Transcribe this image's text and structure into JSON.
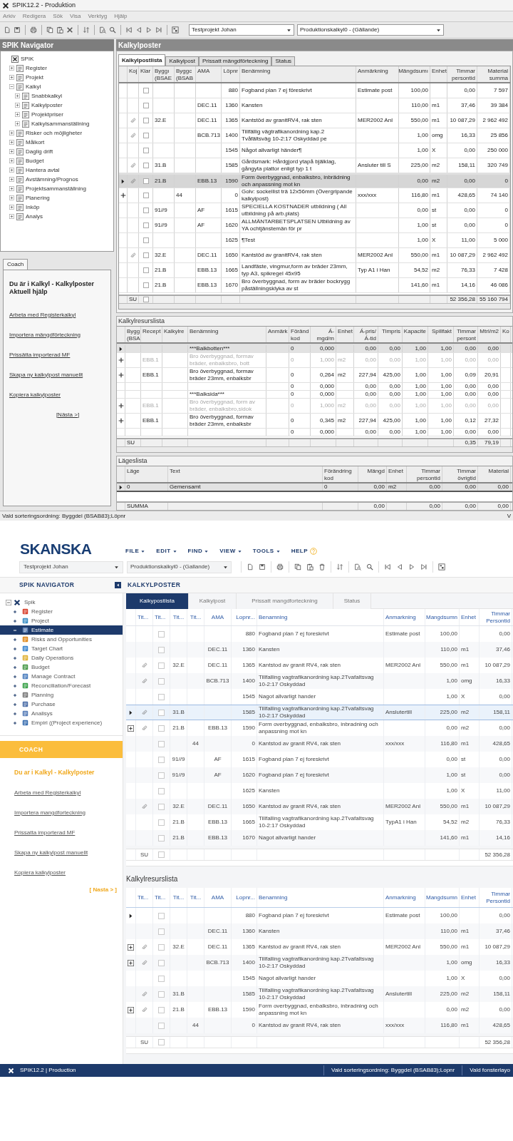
{
  "classic": {
    "window": {
      "title": "SPIK12.2 - Produktion"
    },
    "menu": [
      "Arkiv",
      "Redigera",
      "Sök",
      "Visa",
      "Verktyg",
      "Hjälp"
    ],
    "project_select": {
      "value": "Testprojekt Johan"
    },
    "estimate_select": {
      "value": "Produktionskalkyl0 -  (Gällande)"
    },
    "navigator": {
      "title": "SPIK Navigator",
      "tree": [
        {
          "label": "SPIK",
          "children": [
            {
              "label": "Register",
              "expanded": false
            },
            {
              "label": "Projekt",
              "expanded": false
            },
            {
              "label": "Kalkyl",
              "expanded": true,
              "children": [
                {
                  "label": "Snabbkalkyl",
                  "expanded": false
                },
                {
                  "label": "Kalkylposter",
                  "expanded": false
                },
                {
                  "label": "Projektpriser",
                  "expanded": false
                },
                {
                  "label": "Kalkylsammanställning",
                  "expanded": false
                }
              ]
            },
            {
              "label": "Risker och möjligheter",
              "expanded": false
            },
            {
              "label": "Målkort",
              "expanded": false
            },
            {
              "label": "Daglig drift",
              "expanded": false
            },
            {
              "label": "Budget",
              "expanded": false
            },
            {
              "label": "Hantera avtal",
              "expanded": false
            },
            {
              "label": "Avstämning/Prognos",
              "expanded": false
            },
            {
              "label": "Projektsammanställning",
              "expanded": false
            },
            {
              "label": "Planering",
              "expanded": false
            },
            {
              "label": "Inköp",
              "expanded": false
            },
            {
              "label": "Analys",
              "expanded": false
            }
          ]
        }
      ]
    },
    "coach": {
      "tab": "Coach",
      "title": "Du är i Kalkyl - Kalkylposter",
      "subtitle": "Aktuell hjälp",
      "links": [
        "Arbeta med Registerkalkyl",
        "Importera mängdförteckning",
        "Prissätta importerad MF",
        "Skapa ny kalkylpost manuellt",
        "Kopiera kalkylposter"
      ],
      "next": "[Nästa >]"
    },
    "content_title": "Kalkylposter",
    "tabs": [
      {
        "label": "Kalkylpostlista",
        "selected": true
      },
      {
        "label": "Kalkylpost",
        "selected": false
      },
      {
        "label": "Prissatt mängdförteckning",
        "selected": false
      },
      {
        "label": "Status",
        "selected": false
      }
    ],
    "estimate_table": {
      "columns": [
        "Koj",
        "Klar",
        "Byggı (BSAE",
        "Byggc (BSAB",
        "AMA",
        "Löpnr",
        "Benämning",
        "Anmärkning",
        "Mängdsumı",
        "Enhet",
        "Timmar persontid",
        "Material summa"
      ],
      "rows": [
        {
          "current": false,
          "expandable": false,
          "attachment": false,
          "checked": false,
          "selected": false,
          "cells": [
            "",
            "",
            "",
            "",
            "",
            "880",
            "Fogband plan 7 ej föreskrivt",
            "Estimate post",
            "100,00",
            "",
            "0,00",
            "7 597"
          ]
        },
        {
          "current": false,
          "expandable": false,
          "attachment": false,
          "checked": false,
          "selected": false,
          "cells": [
            "",
            "",
            "",
            "",
            "DEC.11",
            "1360",
            "Kansten",
            "",
            "110,00",
            "m1",
            "37,46",
            "39 384"
          ]
        },
        {
          "current": false,
          "expandable": false,
          "attachment": true,
          "checked": false,
          "selected": false,
          "cells": [
            "",
            "",
            "32.E",
            "",
            "DEC.11",
            "1365",
            "Kantstöd av granitRV4, rak sten",
            "MER2002 Anl",
            "550,00",
            "m1",
            "10 087,29",
            "2 962 492"
          ]
        },
        {
          "current": false,
          "expandable": false,
          "attachment": true,
          "checked": false,
          "selected": false,
          "cells": [
            "",
            "",
            "",
            "",
            "BCB.713",
            "1400",
            "Tillfällig vägtrafikanordning kap.2 Tvåfältsväg 10-2:17 Oskyddad pe",
            "",
            "1,00",
            "omg",
            "16,33",
            "25 856"
          ]
        },
        {
          "current": false,
          "expandable": false,
          "attachment": false,
          "checked": false,
          "selected": false,
          "cells": [
            "",
            "",
            "",
            "",
            "",
            "1545",
            "Något allvarligt händer¶",
            "",
            "1,00",
            "X",
            "0,00",
            "250 000"
          ]
        },
        {
          "current": false,
          "expandable": false,
          "attachment": true,
          "checked": false,
          "selected": false,
          "cells": [
            "",
            "",
            "31.B",
            "",
            "",
            "1585",
            "Gårdsmark: Hårdgjord ytapå bjälklag, gångyta plattor enligt typ 1 t",
            "Ansluter till S",
            "225,00",
            "m2",
            "158,11",
            "320 749"
          ]
        },
        {
          "current": true,
          "expandable": false,
          "attachment": true,
          "checked": false,
          "selected": true,
          "cells": [
            "",
            "",
            "21.B",
            "",
            "EBB.13",
            "1590",
            "Form överbyggnad, enbalksbro, inbrädning och anpassning mot kn",
            "",
            "0,00",
            "m2",
            "0,00",
            "0"
          ]
        },
        {
          "current": false,
          "expandable": true,
          "attachment": false,
          "checked": false,
          "selected": false,
          "cells": [
            "",
            "",
            "",
            "44",
            "",
            "0",
            "Golv: sockellist trä 12x56mm (Övergripande kalkylpost)",
            "xxx/xxx",
            "116,80",
            "m1",
            "428,65",
            "74 140"
          ]
        },
        {
          "current": false,
          "expandable": false,
          "attachment": false,
          "checked": false,
          "selected": false,
          "cells": [
            "",
            "",
            "91//9",
            "",
            "AF",
            "1615",
            "SPECIELLA KOSTNADER utbildning ( All utbildning på arb.plats)",
            "",
            "0,00",
            "st",
            "0,00",
            "0"
          ]
        },
        {
          "current": false,
          "expandable": false,
          "attachment": false,
          "checked": false,
          "selected": false,
          "cells": [
            "",
            "",
            "91//9",
            "",
            "AF",
            "1620",
            "ALLMÄNTARBETSPLATSEN Utbildning av YA ochtjänstemän för pr",
            "",
            "1,00",
            "st",
            "0,00",
            "0"
          ]
        },
        {
          "current": false,
          "expandable": false,
          "attachment": false,
          "checked": false,
          "selected": false,
          "cells": [
            "",
            "",
            "",
            "",
            "",
            "1625",
            "¶Test",
            "",
            "1,00",
            "X",
            "11,00",
            "5 000"
          ]
        },
        {
          "current": false,
          "expandable": false,
          "attachment": true,
          "checked": false,
          "selected": false,
          "cells": [
            "",
            "",
            "32.E",
            "",
            "DEC.11",
            "1650",
            "Kantstöd av granitRV4, rak sten",
            "MER2002 Anl",
            "550,00",
            "m1",
            "10 087,29",
            "2 962 492"
          ]
        },
        {
          "current": false,
          "expandable": false,
          "attachment": false,
          "checked": false,
          "selected": false,
          "cells": [
            "",
            "",
            "21.B",
            "",
            "EBB.13",
            "1665",
            "Landfäste, vingmur,form av bräder 23mm, typ A3, spikregel 45x95",
            "Typ A1 i Han",
            "54,52",
            "m2",
            "76,33",
            "7 428"
          ]
        },
        {
          "current": false,
          "expandable": false,
          "attachment": false,
          "checked": false,
          "selected": false,
          "cells": [
            "",
            "",
            "21.B",
            "",
            "EBB.13",
            "1670",
            "Bro överbyggnad, form av bräder bockrygg påställningsklyka av st",
            "",
            "141,60",
            "m1",
            "14,16",
            "46 086"
          ]
        }
      ],
      "sum": {
        "checked": false,
        "cells": [
          "SU",
          "",
          "",
          "",
          "",
          "",
          "",
          "",
          "",
          "",
          "52 356,28",
          "55 160 794"
        ]
      }
    },
    "resource_table": {
      "title": "Kalkylresurslista",
      "columns": [
        "Bygg (BSA",
        "Recept",
        "Kalkylre",
        "Benämning",
        "Anmärk",
        "Föränd kod",
        "Á-mgd/m",
        "Enhet",
        "Á-pris/ Á-tid",
        "Timpris",
        "Kapacite",
        "Spillfakt",
        "Timmar persont",
        "Mtrl/m2",
        "Ko"
      ],
      "rows": [
        {
          "current": true,
          "expandable": false,
          "disabled": false,
          "selected": true,
          "cells": [
            "",
            "",
            "",
            "***Balkbotten***",
            "",
            "0",
            "0,000",
            "",
            "0,00",
            "0,00",
            "1,00",
            "1,00",
            "0,00",
            "0,00",
            ""
          ]
        },
        {
          "current": false,
          "expandable": true,
          "disabled": true,
          "selected": false,
          "cells": [
            "",
            "EBB.1",
            "",
            "Bro överbyggnad, formav bräder, enbalksbro, bott",
            "",
            "0",
            "1,000",
            "m2",
            "0,00",
            "0,00",
            "1,00",
            "1,00",
            "0,00",
            "0,00",
            ""
          ]
        },
        {
          "current": false,
          "expandable": true,
          "disabled": false,
          "selected": false,
          "cells": [
            "",
            "EBB.1",
            "",
            "Bro överbyggnad, formav bräder 23mm, enbalksbr",
            "",
            "0",
            "0,264",
            "m2",
            "227,94",
            "425,00",
            "1,00",
            "1,00",
            "0,09",
            "20,91",
            ""
          ]
        },
        {
          "current": false,
          "expandable": false,
          "disabled": false,
          "selected": false,
          "cells": [
            "",
            "",
            "",
            "",
            "",
            "0",
            "0,000",
            "",
            "0,00",
            "0,00",
            "1,00",
            "1,00",
            "0,00",
            "0,00",
            ""
          ]
        },
        {
          "current": false,
          "expandable": false,
          "disabled": false,
          "selected": false,
          "cells": [
            "",
            "",
            "",
            "***Balksida***",
            "",
            "0",
            "0,000",
            "",
            "0,00",
            "0,00",
            "1,00",
            "1,00",
            "0,00",
            "0,00",
            ""
          ]
        },
        {
          "current": false,
          "expandable": true,
          "disabled": true,
          "selected": false,
          "cells": [
            "",
            "EBB.1",
            "",
            "Bro överbyggnad, form av bräder, enbalksbro,sidok",
            "",
            "0",
            "1,000",
            "m2",
            "0,00",
            "0,00",
            "1,00",
            "1,00",
            "0,00",
            "0,00",
            ""
          ]
        },
        {
          "current": false,
          "expandable": true,
          "disabled": false,
          "selected": false,
          "cells": [
            "",
            "EBB.1",
            "",
            "Bro överbyggnad, formav bräder 23mm, enbalksbr",
            "",
            "0",
            "0,345",
            "m2",
            "227,94",
            "425,00",
            "1,00",
            "1,00",
            "0,12",
            "27,32",
            ""
          ]
        },
        {
          "current": false,
          "expandable": false,
          "disabled": false,
          "selected": false,
          "cells": [
            "",
            "",
            "",
            "",
            "",
            "0",
            "0,000",
            "",
            "0,00",
            "0,00",
            "1,00",
            "1,00",
            "0,00",
            "0,00",
            ""
          ]
        }
      ],
      "sum": {
        "cells": [
          "SU",
          "",
          "",
          "",
          "",
          "",
          "",
          "",
          "",
          "",
          "",
          "",
          "0,35",
          "79,19",
          ""
        ]
      }
    },
    "location_table": {
      "title": "Lägeslista",
      "columns": [
        "Läge",
        "Text",
        "Förändring kod",
        "Mängd",
        "Enhet",
        "Timmar persontid",
        "Timmar övrigtid",
        "Material"
      ],
      "rows": [
        {
          "current": true,
          "selected": true,
          "cells": [
            "0",
            "Gemensamt",
            "0",
            "0,00",
            "m2",
            "0,00",
            "0,00",
            "0,00"
          ]
        }
      ],
      "sum": {
        "cells": [
          "SUMMA",
          "",
          "",
          "0,00",
          "",
          "0,00",
          "0,00",
          "0,00"
        ]
      }
    },
    "status_bar": {
      "sort_order": "Vald sorteringsordning: Byggdel (BSAB83);Löpnr",
      "column_2": "V"
    }
  },
  "modern": {
    "logo": "SKANSKA",
    "menu": [
      {
        "label": "FILE",
        "kind": "dropdown"
      },
      {
        "label": "EDIT",
        "kind": "dropdown"
      },
      {
        "label": "FIND",
        "kind": "dropdown"
      },
      {
        "label": "VIEW",
        "kind": "dropdown"
      },
      {
        "label": "TOOLS",
        "kind": "dropdown"
      },
      {
        "label": "HELP",
        "kind": "help"
      }
    ],
    "project_select": {
      "value": "Testprojekt Johan"
    },
    "estimate_select": {
      "value": "Produktionskalkyl0 - (Gallande)"
    },
    "navigator": {
      "title": "SPIK NAVIGATOR",
      "tree": [
        {
          "label": "Spik",
          "expanded": true,
          "selected": false,
          "children": [
            {
              "label": "Register",
              "expanded": false,
              "selected": false
            },
            {
              "label": "Project",
              "expanded": false,
              "selected": false
            },
            {
              "label": "Estimate",
              "expanded": true,
              "selected": true
            },
            {
              "label": "Risks and Opportunities",
              "expanded": false,
              "selected": false
            },
            {
              "label": "Target Chart",
              "expanded": false,
              "selected": false
            },
            {
              "label": "Daily Operations",
              "expanded": false,
              "selected": false
            },
            {
              "label": "Budget",
              "expanded": false,
              "selected": false
            },
            {
              "label": "Manage Contract",
              "expanded": false,
              "selected": false
            },
            {
              "label": "Reconciliation/Forecast",
              "expanded": false,
              "selected": false
            },
            {
              "label": "Planning",
              "expanded": false,
              "selected": false
            },
            {
              "label": "Purchase",
              "expanded": false,
              "selected": false
            },
            {
              "label": "Analisys",
              "expanded": false,
              "selected": false
            },
            {
              "label": "Empiri ((Project experience)",
              "expanded": false,
              "selected": false
            }
          ]
        }
      ]
    },
    "coach": {
      "title": "COACH",
      "heading": "Du ar i Kalkyl - Kalkylposter",
      "links": [
        "Arbeta med Registerkalkyl",
        "Importera mangdforteckning",
        "Prissatta importerad MF",
        "Skapa ny kalkylpost manuellt",
        "Kopiera kalkylposter"
      ],
      "next": "[ Nasta > ]"
    },
    "content_title": "KALKYLPOSTER",
    "tabs": [
      {
        "label": "Kalkypostlista",
        "selected": true
      },
      {
        "label": "Kalkylpost",
        "selected": false
      },
      {
        "label": "Prissatt mangdforteckning",
        "selected": false
      },
      {
        "label": "Status",
        "selected": false
      }
    ],
    "estimate_table": {
      "columns": [
        "Tit...",
        "Tit...",
        "Tit...",
        "Tit...",
        "AMA",
        "Lopnr...",
        "Benamning",
        "Anmarkning",
        "Mangdsumn",
        "Enhet",
        "Timmar Persontid"
      ],
      "rows": [
        {
          "current": false,
          "expandable": false,
          "attachment": false,
          "checked": false,
          "selected": false,
          "cells": [
            "",
            "",
            "",
            "",
            "",
            "880",
            "Fogband plan 7 ej foreskrivt",
            "Estimate post",
            "100,00",
            "",
            "0,00"
          ]
        },
        {
          "current": false,
          "expandable": false,
          "attachment": false,
          "checked": false,
          "selected": false,
          "cells": [
            "",
            "",
            "",
            "",
            "DEC.11",
            "1360",
            "Kansten",
            "",
            "110,00",
            "m1",
            "37,46"
          ]
        },
        {
          "current": false,
          "expandable": false,
          "attachment": true,
          "checked": false,
          "selected": false,
          "cells": [
            "",
            "",
            "32.E",
            "",
            "DEC.11",
            "1365",
            "Kantstod av granit RV4, rak sten",
            "MER2002 Anl",
            "550,00",
            "m1",
            "10 087,29"
          ]
        },
        {
          "current": false,
          "expandable": false,
          "attachment": true,
          "checked": false,
          "selected": false,
          "cells": [
            "",
            "",
            "",
            "",
            "BCB.713",
            "1400",
            "Tillfalling vagtrafikanordning kap.2Tvafaltsvag 10-2:17 Oskyddad",
            "",
            "1,00",
            "omg",
            "16,33"
          ]
        },
        {
          "current": false,
          "expandable": false,
          "attachment": false,
          "checked": false,
          "selected": false,
          "cells": [
            "",
            "",
            "",
            "",
            "",
            "1545",
            "Nagot allvarligt hander",
            "",
            "1,00",
            "X",
            "0,00"
          ]
        },
        {
          "current": true,
          "expandable": false,
          "attachment": true,
          "checked": false,
          "selected": true,
          "cells": [
            "",
            "",
            "31.B",
            "",
            "",
            "1585",
            "Tillfalling vagtrafikanordning kap.2Tvafaltsvag 10-2:17 Oskyddad",
            "Anslutertill",
            "225,00",
            "m2",
            "158,11"
          ]
        },
        {
          "current": false,
          "expandable": true,
          "attachment": true,
          "checked": false,
          "selected": false,
          "cells": [
            "",
            "",
            "21.B",
            "",
            "EBB.13",
            "1590",
            "Form overbyggnad, enbalksbro, inbradning och anpassning mot kn",
            "",
            "0,00",
            "m2",
            "0,00"
          ]
        },
        {
          "current": false,
          "expandable": false,
          "attachment": false,
          "checked": false,
          "selected": false,
          "cells": [
            "",
            "",
            "",
            "44",
            "",
            "0",
            "Kantstod av granit RV4, rak sten",
            "xxx/xxx",
            "116,80",
            "m1",
            "428,65"
          ]
        },
        {
          "current": false,
          "expandable": false,
          "attachment": false,
          "checked": false,
          "selected": false,
          "cells": [
            "",
            "",
            "91//9",
            "",
            "AF",
            "1615",
            "Fogband plan 7 ej foreskrivt",
            "",
            "0,00",
            "st",
            "0,00"
          ]
        },
        {
          "current": false,
          "expandable": false,
          "attachment": false,
          "checked": false,
          "selected": false,
          "cells": [
            "",
            "",
            "91//9",
            "",
            "AF",
            "1620",
            "Fogband plan 7 ej foreskrivt",
            "",
            "1,00",
            "st",
            "0,00"
          ]
        },
        {
          "current": false,
          "expandable": false,
          "attachment": false,
          "checked": false,
          "selected": false,
          "cells": [
            "",
            "",
            "",
            "",
            "",
            "1625",
            "Kansten",
            "",
            "1,00",
            "X",
            "11,00"
          ]
        },
        {
          "current": false,
          "expandable": false,
          "attachment": true,
          "checked": false,
          "selected": false,
          "cells": [
            "",
            "",
            "32.E",
            "",
            "DEC.11",
            "1650",
            "Kantstod av granit RV4, rak sten",
            "MER2002 Anl",
            "550,00",
            "m1",
            "10 087,29"
          ]
        },
        {
          "current": false,
          "expandable": false,
          "attachment": false,
          "checked": false,
          "selected": false,
          "cells": [
            "",
            "",
            "21.B",
            "",
            "EBB.13",
            "1665",
            "Tillfalling vagtrafikanordning kap.2Tvafaltsvag 10-2:17 Oskyddad",
            "TypA1 i Han",
            "54,52",
            "m2",
            "76,33"
          ]
        },
        {
          "current": false,
          "expandable": false,
          "attachment": false,
          "checked": false,
          "selected": false,
          "cells": [
            "",
            "",
            "21.B",
            "",
            "EBB.13",
            "1670",
            "Nagot allvarligt hander",
            "",
            "141,60",
            "m1",
            "14,16"
          ]
        }
      ],
      "sum": {
        "checked": false,
        "cells": [
          "SU",
          "",
          "",
          "",
          "",
          "",
          "",
          "",
          "",
          "",
          "52 356,28"
        ]
      }
    },
    "resource_table": {
      "title": "Kalkylresurslista",
      "columns": [
        "Tit...",
        "Tit...",
        "Tit...",
        "Tit...",
        "AMA",
        "Lopnr...",
        "Benamning",
        "Anmarkning",
        "Mangdsumn",
        "Enhet",
        "Timmar Persontid"
      ],
      "rows": [
        {
          "current": true,
          "expandable": false,
          "attachment": false,
          "checked": false,
          "selected": false,
          "cells": [
            "",
            "",
            "",
            "",
            "",
            "880",
            "Fogband plan 7 ej foreskrivt",
            "Estimate post",
            "100,00",
            "",
            "0,00"
          ]
        },
        {
          "current": false,
          "expandable": false,
          "attachment": false,
          "checked": false,
          "selected": false,
          "cells": [
            "",
            "",
            "",
            "",
            "DEC.11",
            "1360",
            "Kansten",
            "",
            "110,00",
            "m1",
            "37,46"
          ]
        },
        {
          "current": false,
          "expandable": true,
          "attachment": true,
          "checked": false,
          "selected": false,
          "cells": [
            "",
            "",
            "32.E",
            "",
            "DEC.11",
            "1365",
            "Kantstod av granit RV4, rak sten",
            "MER2002 Anl",
            "550,00",
            "m1",
            "10 087,29"
          ]
        },
        {
          "current": false,
          "expandable": true,
          "attachment": true,
          "checked": false,
          "selected": false,
          "cells": [
            "",
            "",
            "",
            "",
            "BCB.713",
            "1400",
            "Tillfalling vagtrafikanordning kap.2Tvafaltsvag 10-2:17 Oskyddad",
            "",
            "1,00",
            "omg",
            "16,33"
          ]
        },
        {
          "current": false,
          "expandable": false,
          "attachment": false,
          "checked": false,
          "selected": false,
          "cells": [
            "",
            "",
            "",
            "",
            "",
            "1545",
            "Nagot allvarligt hander",
            "",
            "1,00",
            "X",
            "0,00"
          ]
        },
        {
          "current": false,
          "expandable": false,
          "attachment": true,
          "checked": false,
          "selected": false,
          "cells": [
            "",
            "",
            "31.B",
            "",
            "",
            "1585",
            "Tillfalling vagtrafikanordning kap.2Tvafaltsvag 10-2:17 Oskyddad",
            "Anslutertill",
            "225,00",
            "m2",
            "158,11"
          ]
        },
        {
          "current": false,
          "expandable": true,
          "attachment": true,
          "checked": false,
          "selected": false,
          "cells": [
            "",
            "",
            "21.B",
            "",
            "EBB.13",
            "1590",
            "Form overbyggnad, enbalksbro, inbradning och anpassning mot kn",
            "",
            "0,00",
            "m2",
            "0,00"
          ]
        },
        {
          "current": false,
          "expandable": false,
          "attachment": false,
          "checked": false,
          "selected": false,
          "cells": [
            "",
            "",
            "",
            "44",
            "",
            "0",
            "Kantstod av granit RV4, rak sten",
            "xxx/xxx",
            "116,80",
            "m1",
            "428,65"
          ]
        }
      ],
      "sum": {
        "checked": false,
        "cells": [
          "SU",
          "",
          "",
          "",
          "",
          "",
          "",
          "",
          "",
          "",
          "52 356,28"
        ]
      }
    },
    "status_bar": {
      "app": "SPIK12.2 | Production",
      "sort_order": "Vald sorteringsordning: Byggdel (BSAB83);Lopnr",
      "layout": "Vald fonsterlayo"
    }
  }
}
